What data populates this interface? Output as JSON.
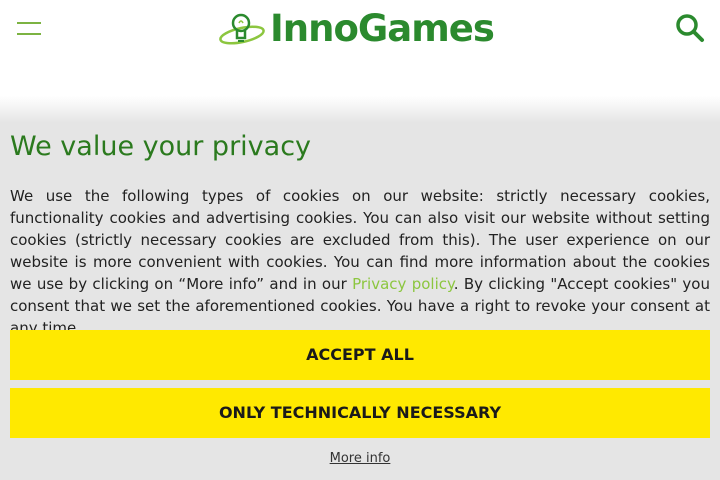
{
  "header": {
    "logo_text": "InnoGames",
    "menu_icon": "hamburger-menu-icon",
    "search_icon": "search-icon",
    "brand_color": "#2b8a2e",
    "accent_color": "#7cb342"
  },
  "cookie_banner": {
    "title": "We value your privacy",
    "text_before_link": "We use the following types of cookies on our website: strictly necessary cookies, functionality cookies and advertising cookies. You can also visit our website without setting cookies (strictly necessary cookies are excluded from this). The user experience on our website is more convenient with cookies. You can find more information about the cookies we use by clicking on “More info” and in our ",
    "privacy_link": "Privacy policy",
    "text_after_link": ". By clicking \"Accept cookies\" you consent that we set the aforementioned cookies. You have a right to revoke your consent at any time.",
    "accept_all_label": "ACCEPT ALL",
    "necessary_label": "ONLY TECHNICALLY NECESSARY",
    "more_info_label": "More info",
    "button_color": "#ffe900",
    "background_color": "#e5e5e5"
  }
}
